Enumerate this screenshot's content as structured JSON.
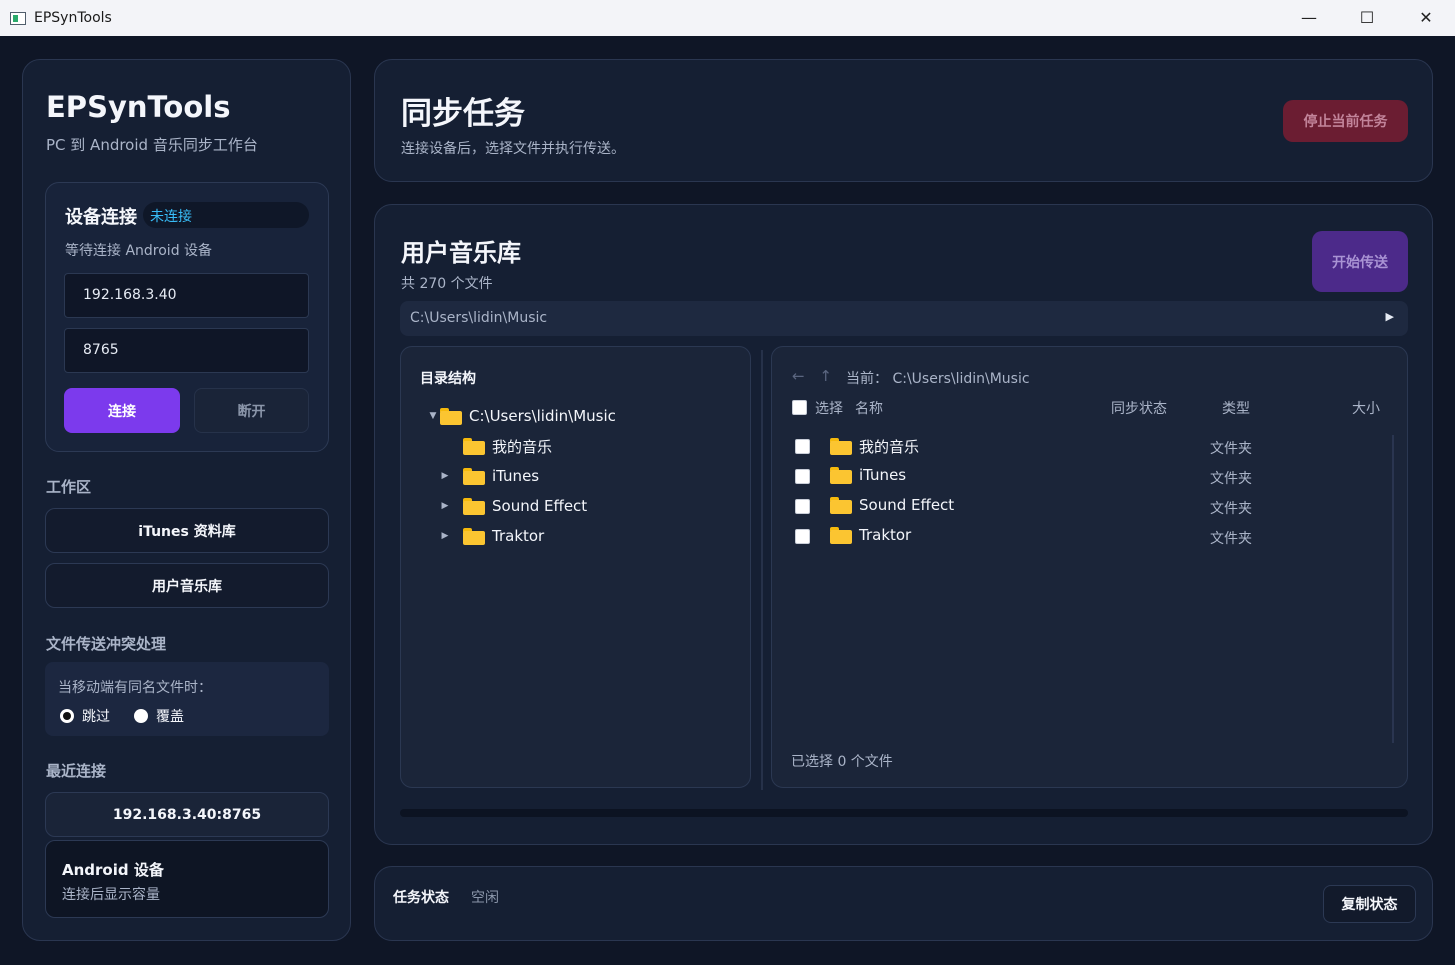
{
  "window": {
    "title": "EPSynTools",
    "minimize_glyph": "—",
    "maximize_glyph": "☐",
    "close_glyph": "✕"
  },
  "sidebar": {
    "brand": "EPSynTools",
    "subtitle": "PC 到 Android 音乐同步工作台",
    "device": {
      "title": "设备连接",
      "status": "未连接",
      "hint": "等待连接 Android 设备",
      "ip": "192.168.3.40",
      "port": "8765",
      "connect_label": "连接",
      "disconnect_label": "断开"
    },
    "workspace": {
      "label": "工作区",
      "items": [
        "iTunes 资料库",
        "用户音乐库"
      ]
    },
    "conflict": {
      "label": "文件传送冲突处理",
      "question": "当移动端有同名文件时：",
      "options": [
        "跳过",
        "覆盖"
      ],
      "selected": "跳过"
    },
    "recent": {
      "label": "最近连接",
      "items": [
        "192.168.3.40:8765"
      ]
    },
    "android": {
      "title": "Android 设备",
      "subtitle": "连接后显示容量"
    }
  },
  "header": {
    "title": "同步任务",
    "subtitle": "连接设备后，选择文件并执行传送。",
    "stop_label": "停止当前任务"
  },
  "library": {
    "title": "用户音乐库",
    "count": "共 270 个文件",
    "start_label": "开始传送",
    "path": "C:\\Users\\lidin\\Music",
    "tree": {
      "heading": "目录结构",
      "root": "C:\\Users\\lidin\\Music",
      "children": [
        "我的音乐",
        "iTunes",
        "Sound Effect",
        "Traktor"
      ]
    },
    "files": {
      "current_label": "当前：",
      "current_path": "C:\\Users\\lidin\\Music",
      "columns": {
        "select": "选择",
        "name": "名称",
        "status": "同步状态",
        "type": "类型",
        "size": "大小"
      },
      "rows": [
        {
          "name": "我的音乐",
          "status": "",
          "type": "文件夹",
          "size": ""
        },
        {
          "name": "iTunes",
          "status": "",
          "type": "文件夹",
          "size": ""
        },
        {
          "name": "Sound Effect",
          "status": "",
          "type": "文件夹",
          "size": ""
        },
        {
          "name": "Traktor",
          "status": "",
          "type": "文件夹",
          "size": ""
        }
      ],
      "selected_count": "已选择 0 个文件"
    },
    "progress": 0
  },
  "task": {
    "label": "任务状态",
    "value": "空闲",
    "copy_label": "复制状态"
  },
  "colors": {
    "accent": "#7c3aed",
    "status_disconnected": "#38bdf8",
    "danger": "#6b1d32",
    "folder": "#fbc531"
  }
}
